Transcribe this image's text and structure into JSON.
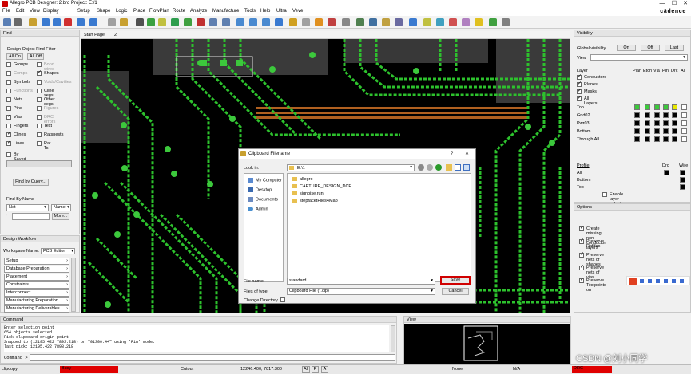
{
  "window": {
    "title": "Allegro PCB Designer: 2.brd  Project: E:/1",
    "min": "—",
    "max": "☐",
    "close": "✕"
  },
  "brand": "cādence",
  "menu": [
    "File",
    "Edit",
    "View",
    "Display",
    "Setup",
    "Shape",
    "Logic",
    "Place",
    "FlowPlan",
    "Route",
    "Analyze",
    "Manufacture",
    "Tools",
    "Help",
    "Ultra",
    "Veve"
  ],
  "find": {
    "title": "Find",
    "filter_title": "Design Object Find Filter",
    "all_on": "All On",
    "all_off": "All Off",
    "items": [
      {
        "label": "Groups",
        "checked": false,
        "enabled": true
      },
      {
        "label": "Bond wires",
        "checked": false,
        "enabled": false
      },
      {
        "label": "Comps",
        "checked": false,
        "enabled": false
      },
      {
        "label": "Shapes",
        "checked": true,
        "enabled": true
      },
      {
        "label": "Symbols",
        "checked": false,
        "enabled": true
      },
      {
        "label": "Voids/Cavities",
        "checked": false,
        "enabled": false
      },
      {
        "label": "Functions",
        "checked": false,
        "enabled": false
      },
      {
        "label": "Cline segs",
        "checked": false,
        "enabled": true
      },
      {
        "label": "Nets",
        "checked": false,
        "enabled": true
      },
      {
        "label": "Other segs",
        "checked": false,
        "enabled": true
      },
      {
        "label": "Pins",
        "checked": false,
        "enabled": true
      },
      {
        "label": "Figures",
        "checked": false,
        "enabled": false
      },
      {
        "label": "Vias",
        "checked": true,
        "enabled": true
      },
      {
        "label": "DRC errors",
        "checked": false,
        "enabled": false
      },
      {
        "label": "Fingers",
        "checked": false,
        "enabled": true
      },
      {
        "label": "Text",
        "checked": false,
        "enabled": true
      },
      {
        "label": "Clines",
        "checked": true,
        "enabled": true
      },
      {
        "label": "Ratsnests",
        "checked": false,
        "enabled": true
      },
      {
        "label": "Lines",
        "checked": true,
        "enabled": true
      },
      {
        "label": "Rat Ts",
        "checked": false,
        "enabled": true
      }
    ],
    "by_saved_query": "By Saved Query",
    "find_by_query": "Find by Query...",
    "find_by_name": "Find By Name",
    "net_value": "Net",
    "name_value": "Name",
    "more": "More..."
  },
  "workflow": {
    "title": "Design Workflow",
    "workspace_label": "Workspace Name:",
    "workspace_value": "PCB Editor",
    "items": [
      "Setup",
      "Database Preparation",
      "Placement",
      "Constraints",
      "Interconnect",
      "Manufacturing Preparation",
      "Manufacturing Deliverables"
    ]
  },
  "canvas": {
    "tab": "Start Page",
    "tab_num": "2"
  },
  "dialog": {
    "title": "Clipboard Filename",
    "help": "?",
    "close": "✕",
    "look_in_label": "Look in:",
    "look_in_value": "E:\\1",
    "places": [
      "My Computer",
      "Desktop",
      "Documents",
      "Admin"
    ],
    "files": [
      "allegro",
      "CAPTURE_DESIGN_DCF",
      "signoise.run",
      "stepfacetFiles4Map"
    ],
    "file_name_label": "File name:",
    "file_name_value": "standard",
    "files_of_type_label": "Files of type:",
    "files_of_type_value": "Clipboard File (*.clp)",
    "change_dir": "Change Directory",
    "save": "Save",
    "cancel": "Cancel"
  },
  "visibility": {
    "title": "Visibility",
    "global_label": "Global visibility",
    "on": "On",
    "off": "Off",
    "last": "Last",
    "view_label": "View",
    "layer_header": "Layer",
    "cols": [
      "Plan",
      "Etch",
      "Via",
      "Pin",
      "Drc",
      "All"
    ],
    "layers": [
      "Conductors",
      "Planes",
      "Masks",
      "All Layers"
    ],
    "rows": [
      {
        "name": "Top",
        "colors": [
          "#3cc83c",
          "#3cc83c",
          "#3cc83c",
          "#3cc83c",
          "#e8e800",
          "#ffffff"
        ]
      },
      {
        "name": "Gnd02",
        "colors": [
          "#000000",
          "#000000",
          "#000000",
          "#000000",
          "#000000",
          "#ffffff"
        ]
      },
      {
        "name": "Pwr03",
        "colors": [
          "#000000",
          "#000000",
          "#000000",
          "#000000",
          "#000000",
          "#ffffff"
        ]
      },
      {
        "name": "Bottom",
        "colors": [
          "#000000",
          "#000000",
          "#000000",
          "#000000",
          "#000000",
          "#ffffff"
        ]
      },
      {
        "name": "Through All",
        "colors": [
          "#000000",
          "#000000",
          "#000000",
          "#000000",
          "#000000",
          "#ffffff"
        ]
      }
    ],
    "profile_header": "Profile",
    "profile_cols": [
      "Drc",
      "Wire"
    ],
    "profile_rows": [
      "All",
      "Bottom",
      "Top"
    ],
    "enable_layer_select": "Enable layer select mode"
  },
  "options": {
    "title": "Options",
    "items": [
      {
        "label": "Create missing non-conductor layers",
        "checked": true
      },
      {
        "label": "Preserve Refdes",
        "checked": true
      },
      {
        "label": "Preserve nets of shapes",
        "checked": true
      },
      {
        "label": "Preserve nets of vias",
        "checked": true
      },
      {
        "label": "Preserve Testpoints on",
        "checked": true
      }
    ]
  },
  "command": {
    "title": "Command",
    "lines": [
      "Enter selection point",
      "654 objects selected",
      "Pick clipboard origin point",
      "Snapped to (12195.422 7893.218) on \"01300.44\" using 'Pin' mode.",
      "last pick:  12195.422 7893.218"
    ],
    "prompt": "Command >"
  },
  "view": {
    "title": "View"
  },
  "status": {
    "mode": "clipcopy",
    "state": "Busy",
    "layer": "Cutout",
    "coords": "12246.400, 7817.300",
    "p": "P",
    "a": "A",
    "ab": "All",
    "select": "None",
    "na": "N/A",
    "drc": "DRC"
  },
  "watermark": "CSDN @刘小同学",
  "colors": {
    "trace": "#2dc22d",
    "busy": "#e00000",
    "accent": "#d00000"
  }
}
